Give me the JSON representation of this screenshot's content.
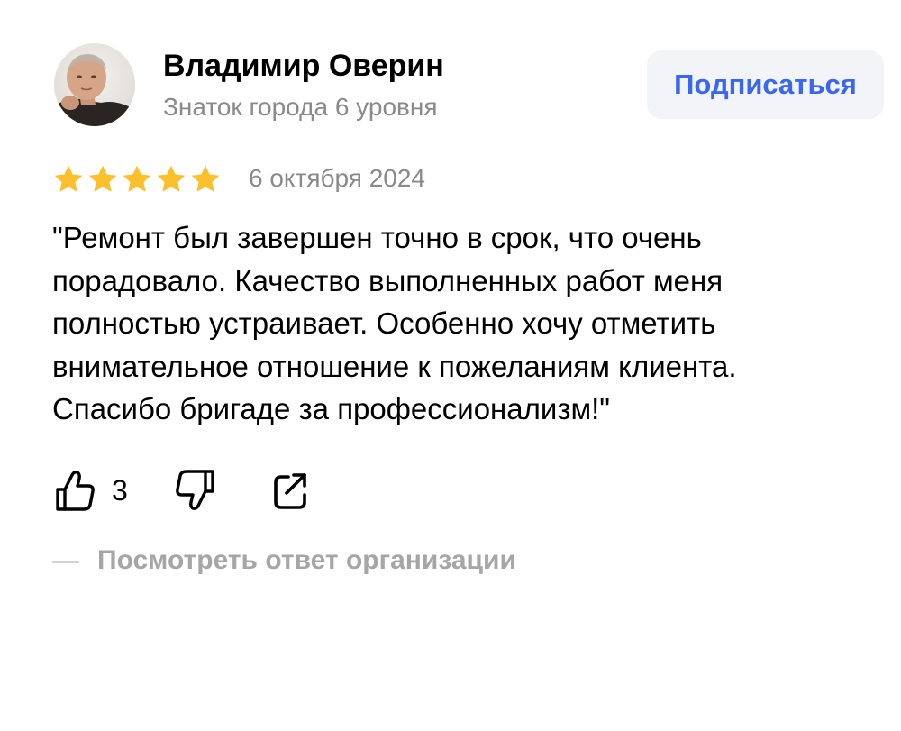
{
  "author": {
    "name": "Владимир Оверин",
    "level": "Знаток города 6 уровня",
    "avatar_icon": "user-photo"
  },
  "subscribe": {
    "label": "Подписаться",
    "color": "#3a67ef",
    "background": "#f2f4f8"
  },
  "review": {
    "rating": 5,
    "rating_max": 5,
    "star_color": "#fcc02d",
    "date": "6 октября 2024",
    "text": "\"Ремонт был завершен точно в срок, что очень порадовало. Качество выполненных работ меня полностью устраивает. Особенно хочу отметить внимательное отношение к пожеланиям клиента. Спасибо бригаде за профессионализм!\""
  },
  "actions": {
    "like_icon": "thumbs-up-icon",
    "like_count": "3",
    "dislike_icon": "thumbs-down-icon",
    "share_icon": "share-icon"
  },
  "org_reply": {
    "dash": "—",
    "label": "Посмотреть ответ организации"
  }
}
